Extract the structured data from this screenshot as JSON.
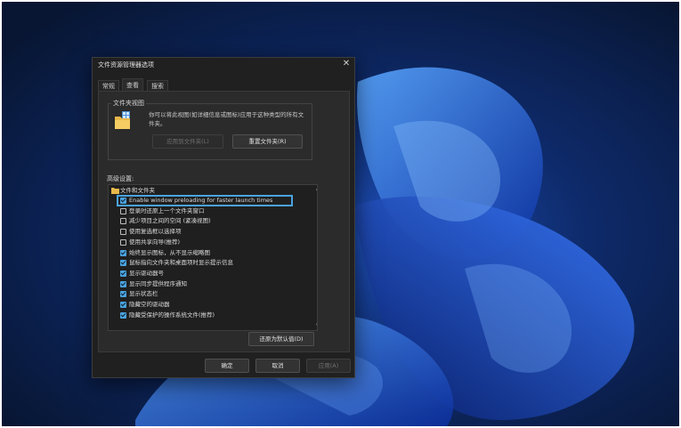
{
  "dialog": {
    "title": "文件资源管理器选项",
    "close_symbol": "✕",
    "tabs": [
      "常规",
      "查看",
      "搜索"
    ],
    "active_tab": "查看"
  },
  "folder_views": {
    "label": "文件夹视图",
    "description": "你可以将此视图(如详细信息或图标)应用于这种类型的所有文件夹。",
    "apply_button": "应用到文件夹(L)",
    "reset_button": "重置文件夹(R)"
  },
  "advanced": {
    "label": "高级设置:",
    "root": "文件和文件夹",
    "items": [
      {
        "text": "Enable window preloading for faster launch times",
        "checked": true,
        "highlighted": true
      },
      {
        "text": "登录时还原上一个文件夹窗口",
        "checked": false
      },
      {
        "text": "减少项目之间的空间 (紧凑视图)",
        "checked": false
      },
      {
        "text": "使用复选框以选择项",
        "checked": false
      },
      {
        "text": "使用共享向导(推荐)",
        "checked": false
      },
      {
        "text": "始终显示图标，从不显示缩略图",
        "checked": true
      },
      {
        "text": "鼠标指向文件夹和桌面项时显示提示信息",
        "checked": true
      },
      {
        "text": "显示驱动器号",
        "checked": true
      },
      {
        "text": "显示同步提供程序通知",
        "checked": true
      },
      {
        "text": "显示状态栏",
        "checked": true
      },
      {
        "text": "隐藏空的驱动器",
        "checked": true
      },
      {
        "text": "隐藏受保护的操作系统文件(推荐)",
        "checked": true
      }
    ],
    "restore_defaults": "还原为默认值(D)"
  },
  "footer": {
    "ok": "确定",
    "cancel": "取消",
    "apply": "应用(A)"
  },
  "colors": {
    "accent": "#4aa3df",
    "dialog_bg": "#202020",
    "wallpaper": "#0a1a3c"
  }
}
